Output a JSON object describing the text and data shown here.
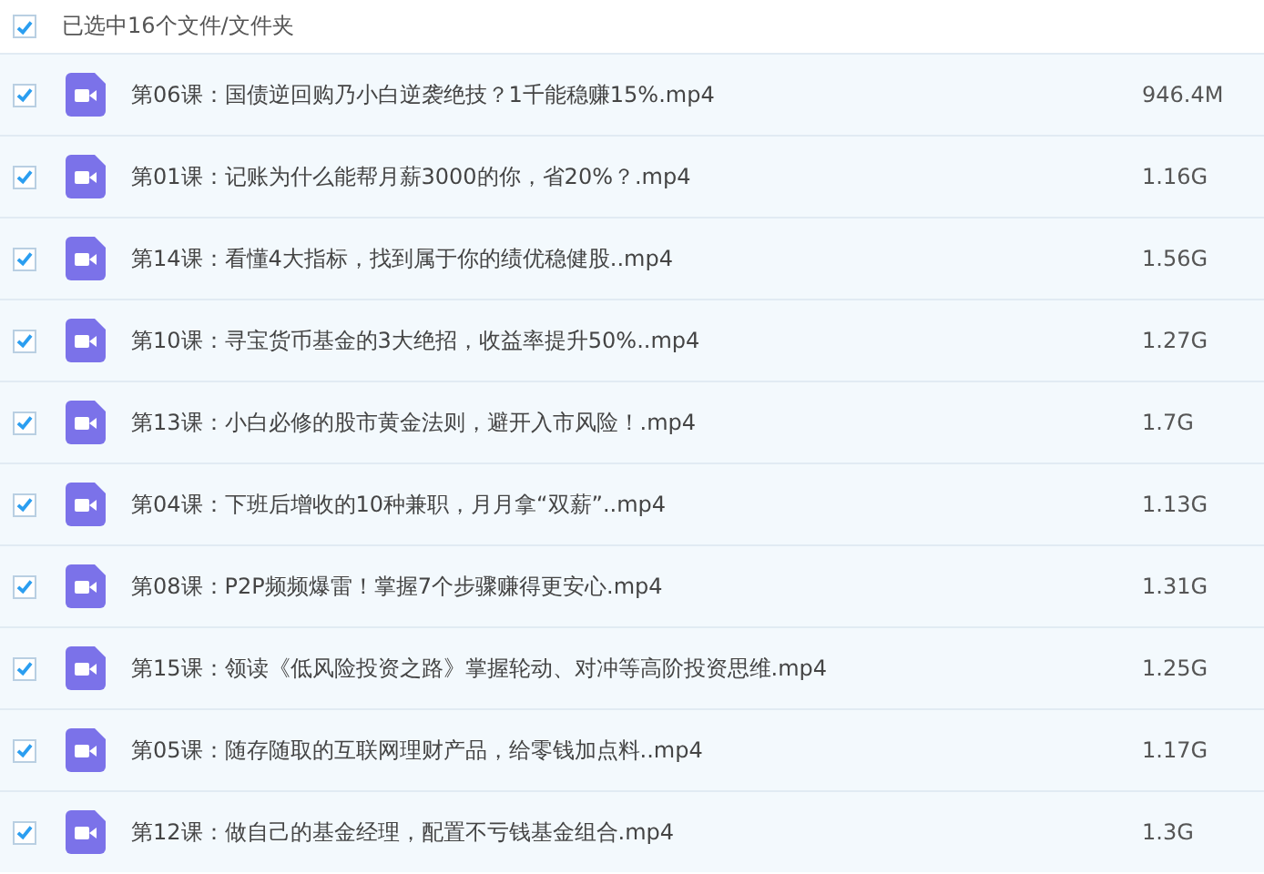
{
  "header": {
    "checked": true,
    "label": "已选中16个文件/文件夹"
  },
  "files": [
    {
      "checked": true,
      "name": "第06课：国债逆回购乃小白逆袭绝技？1千能稳赚15%.mp4",
      "size": "946.4M"
    },
    {
      "checked": true,
      "name": "第01课：记账为什么能帮月薪3000的你，省20%？.mp4",
      "size": "1.16G"
    },
    {
      "checked": true,
      "name": "第14课：看懂4大指标，找到属于你的绩优稳健股..mp4",
      "size": "1.56G"
    },
    {
      "checked": true,
      "name": "第10课：寻宝货币基金的3大绝招，收益率提升50%..mp4",
      "size": "1.27G"
    },
    {
      "checked": true,
      "name": "第13课：小白必修的股市黄金法则，避开入市风险！.mp4",
      "size": "1.7G"
    },
    {
      "checked": true,
      "name": "第04课：下班后增收的10种兼职，月月拿“双薪”..mp4",
      "size": "1.13G"
    },
    {
      "checked": true,
      "name": "第08课：P2P频频爆雷！掌握7个步骤赚得更安心.mp4",
      "size": "1.31G"
    },
    {
      "checked": true,
      "name": "第15课：领读《低风险投资之路》掌握轮动、对冲等高阶投资思维.mp4",
      "size": "1.25G"
    },
    {
      "checked": true,
      "name": "第05课：随存随取的互联网理财产品，给零钱加点料..mp4",
      "size": "1.17G"
    },
    {
      "checked": true,
      "name": "第12课：做自己的基金经理，配置不亏钱基金组合.mp4",
      "size": "1.3G"
    }
  ]
}
